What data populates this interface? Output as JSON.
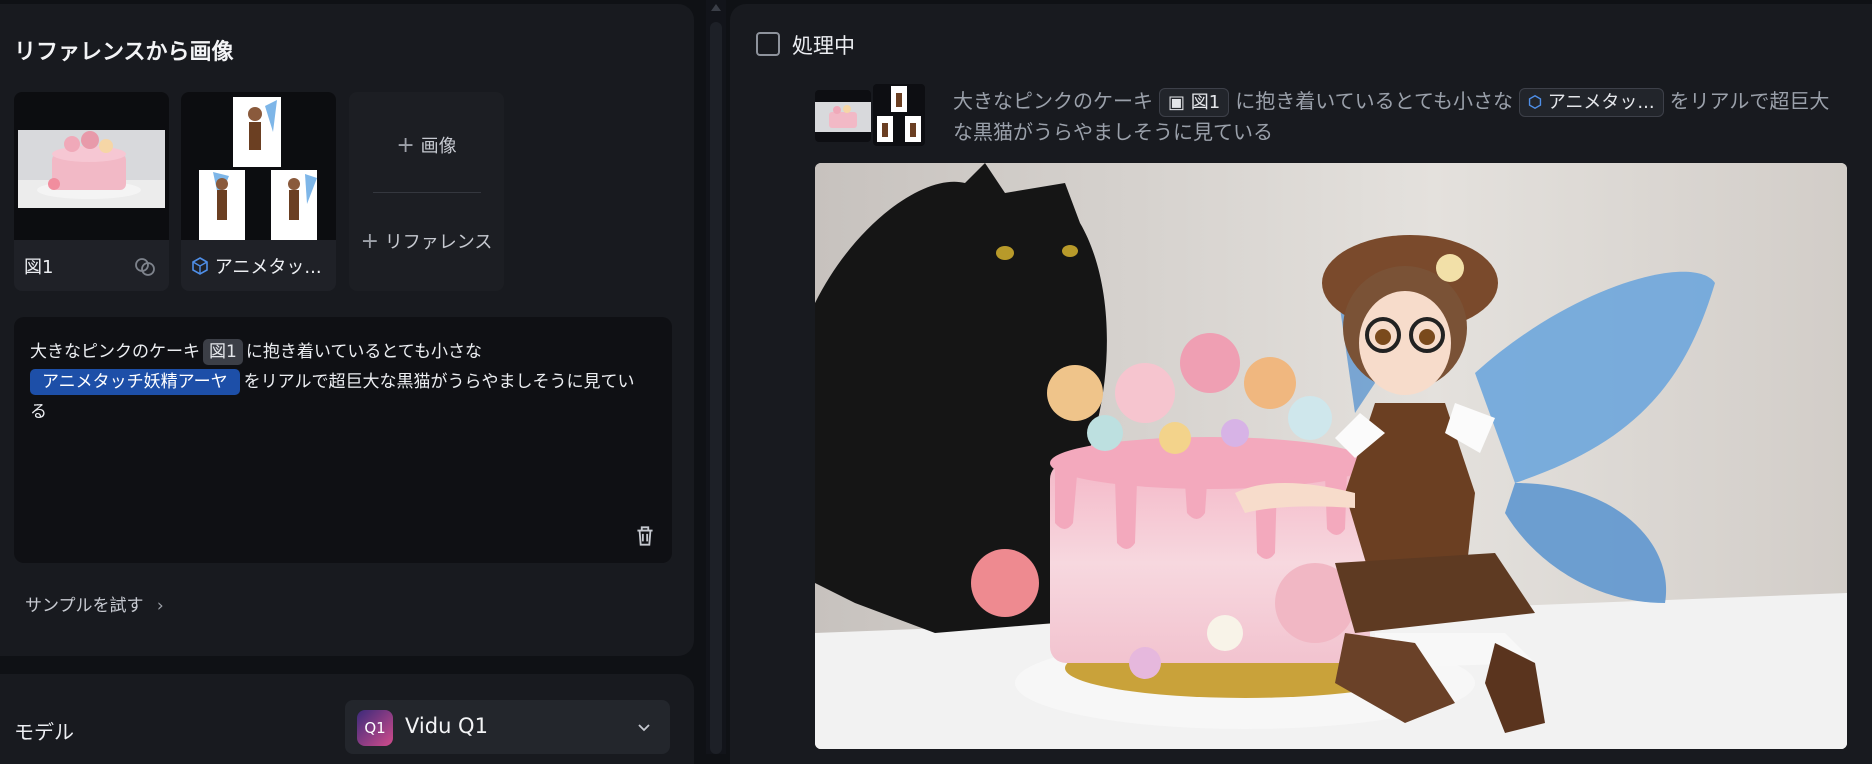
{
  "reference_section": {
    "title": "リファレンスから画像",
    "items": [
      {
        "label": "図1",
        "icon": "face-swap-icon"
      },
      {
        "label": "アニメタッ...",
        "icon": "cube-icon"
      }
    ],
    "add_image_label": "画像",
    "add_reference_label": "リファレンス"
  },
  "prompt": {
    "text_before": "大きなピンクのケーキ",
    "chip1": "図1",
    "text_middle": "に抱き着いているとても小さな",
    "chip2": "アニメタッチ妖精アーヤ",
    "text_after": "をリアルで超巨大な黒猫がうらやましそうに見ている"
  },
  "sample_link": "サンプルを試す",
  "model": {
    "label": "モデル",
    "selected": "Vidu Q1",
    "logo_text": "Q1"
  },
  "result": {
    "status": "処理中",
    "prompt_before": "大きなピンクのケーキ",
    "chip1": "図1",
    "prompt_middle": "に抱き着いているとても小さな",
    "chip2": "アニメタッ...",
    "prompt_after_line1": "をリアルで超巨大",
    "prompt_line2": "な黒猫がうらやましそうに見ている"
  },
  "colors": {
    "accent_blue": "#1d4fa8",
    "panel_bg": "#181a1f",
    "page_bg": "#0f1115"
  }
}
